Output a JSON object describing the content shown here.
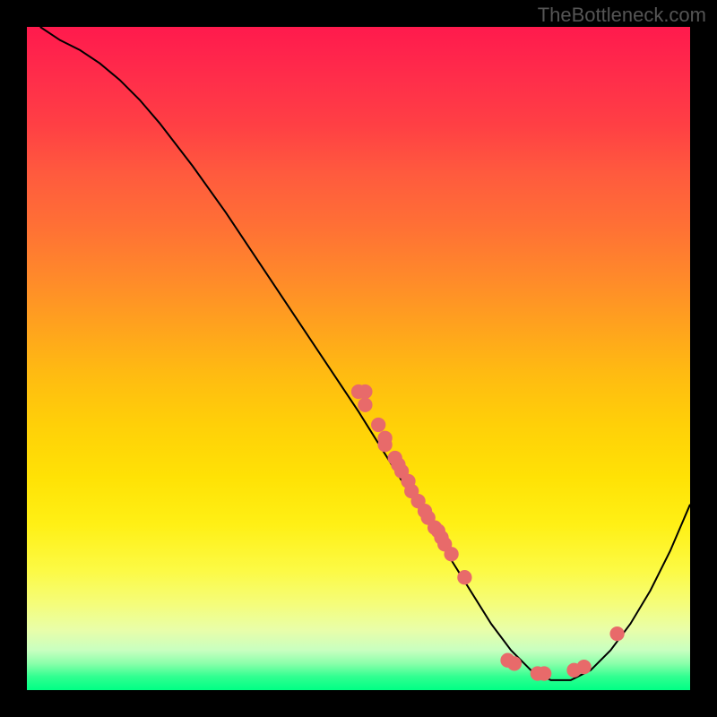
{
  "watermark": "TheBottleneck.com",
  "chart_data": {
    "type": "line",
    "title": "",
    "xlabel": "",
    "ylabel": "",
    "xlim": [
      0,
      100
    ],
    "ylim": [
      0,
      100
    ],
    "curve": [
      {
        "x": 2,
        "y": 100
      },
      {
        "x": 5,
        "y": 98
      },
      {
        "x": 8,
        "y": 96.5
      },
      {
        "x": 11,
        "y": 94.5
      },
      {
        "x": 14,
        "y": 92
      },
      {
        "x": 17,
        "y": 89
      },
      {
        "x": 20,
        "y": 85.5
      },
      {
        "x": 25,
        "y": 79
      },
      {
        "x": 30,
        "y": 72
      },
      {
        "x": 35,
        "y": 64.5
      },
      {
        "x": 40,
        "y": 57
      },
      {
        "x": 45,
        "y": 49.5
      },
      {
        "x": 50,
        "y": 42
      },
      {
        "x": 55,
        "y": 34
      },
      {
        "x": 60,
        "y": 26
      },
      {
        "x": 65,
        "y": 18
      },
      {
        "x": 70,
        "y": 10
      },
      {
        "x": 73,
        "y": 6
      },
      {
        "x": 76,
        "y": 3
      },
      {
        "x": 79,
        "y": 1.5
      },
      {
        "x": 82,
        "y": 1.5
      },
      {
        "x": 85,
        "y": 3
      },
      {
        "x": 88,
        "y": 6
      },
      {
        "x": 91,
        "y": 10
      },
      {
        "x": 94,
        "y": 15
      },
      {
        "x": 97,
        "y": 21
      },
      {
        "x": 100,
        "y": 28
      }
    ],
    "scatter_points": [
      {
        "x": 50,
        "y": 45
      },
      {
        "x": 51,
        "y": 45
      },
      {
        "x": 51,
        "y": 43
      },
      {
        "x": 53,
        "y": 40
      },
      {
        "x": 54,
        "y": 38
      },
      {
        "x": 54,
        "y": 37
      },
      {
        "x": 55.5,
        "y": 35
      },
      {
        "x": 56,
        "y": 34
      },
      {
        "x": 56.5,
        "y": 33
      },
      {
        "x": 57.5,
        "y": 31.5
      },
      {
        "x": 58,
        "y": 30
      },
      {
        "x": 59,
        "y": 28.5
      },
      {
        "x": 60,
        "y": 27
      },
      {
        "x": 60.5,
        "y": 26
      },
      {
        "x": 61.5,
        "y": 24.5
      },
      {
        "x": 62,
        "y": 24
      },
      {
        "x": 62.5,
        "y": 23
      },
      {
        "x": 63,
        "y": 22
      },
      {
        "x": 64,
        "y": 20.5
      },
      {
        "x": 66,
        "y": 17
      },
      {
        "x": 72.5,
        "y": 4.5
      },
      {
        "x": 73.5,
        "y": 4
      },
      {
        "x": 77,
        "y": 2.5
      },
      {
        "x": 78,
        "y": 2.5
      },
      {
        "x": 82.5,
        "y": 3
      },
      {
        "x": 84,
        "y": 3.5
      },
      {
        "x": 89,
        "y": 8.5
      }
    ],
    "point_color": "#e86a6a",
    "curve_color": "#000000"
  }
}
